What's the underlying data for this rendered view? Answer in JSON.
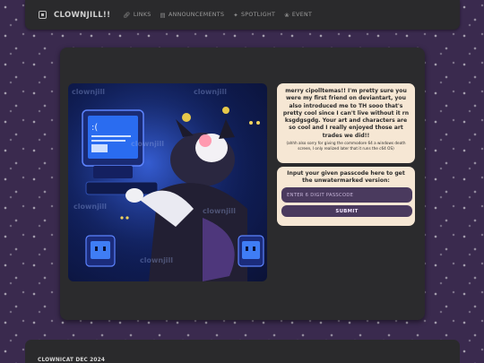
{
  "nav": {
    "brand": "CLOWNJILL!!",
    "links": [
      {
        "label": "LINKS",
        "icon": "link-icon"
      },
      {
        "label": "ANNOUNCEMENTS",
        "icon": "list-icon"
      },
      {
        "label": "SPOTLIGHT",
        "icon": "spotlight-icon"
      },
      {
        "label": "EVENT",
        "icon": "event-icon"
      }
    ]
  },
  "message": {
    "main": "merry cipolltemas!! I'm pretty sure you were my first friend on deviantart, you also introduced me to TH sooo that's pretty cool since I can't live without it rn ksgdgsgdg. Your art and characters are so cool and I really enjoyed those art trades we did!!",
    "note": "(ahhh also sorry for giving the commodore 64 a windows death screen, I only realized later that it runs the c64 OS)"
  },
  "passcode": {
    "prompt": "Input your given passcode here to get the unwatermarked version:",
    "placeholder": "ENTER 6 DIGIT PASSCODE",
    "submit_label": "SUBMIT"
  },
  "artwork": {
    "screen_text": ":( Your PC ran into a problem and needs to restart.",
    "watermark": "clownjill"
  },
  "footer": {
    "text": "CLOWNICAT DEC 2024"
  },
  "colors": {
    "background": "#3a2a4e",
    "panel": "#2b2b2d",
    "card": "#f6e7d4",
    "input": "#4a3a5e"
  }
}
